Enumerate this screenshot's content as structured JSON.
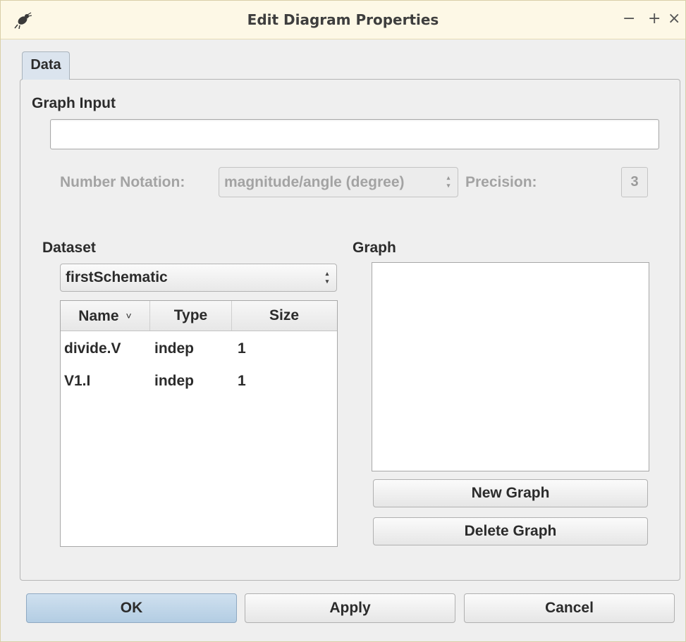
{
  "window": {
    "title": "Edit Diagram Properties",
    "controls": {
      "minimize": "−",
      "maximize": "+",
      "close": "×"
    }
  },
  "tabs": [
    {
      "label": "Data",
      "selected": true
    }
  ],
  "graph_input": {
    "label": "Graph Input",
    "value": ""
  },
  "number_notation": {
    "label": "Number Notation:",
    "selected": "magnitude/angle (degree)",
    "enabled": false
  },
  "precision": {
    "label": "Precision:",
    "value": "3",
    "enabled": false
  },
  "dataset": {
    "label": "Dataset",
    "selected": "firstSchematic",
    "columns": [
      "Name",
      "Type",
      "Size"
    ],
    "sort_column": "Name",
    "rows": [
      {
        "name": "divide.V",
        "type": "indep",
        "size": "1"
      },
      {
        "name": "V1.I",
        "type": "indep",
        "size": "1"
      }
    ]
  },
  "graph": {
    "label": "Graph",
    "items": [],
    "new_button": "New Graph",
    "delete_button": "Delete Graph"
  },
  "footer": {
    "ok": "OK",
    "apply": "Apply",
    "cancel": "Cancel"
  },
  "colors": {
    "accent_button": "#b3cde3",
    "title_bar": "#fdf8e6",
    "tab_selected": "#dbe4ee"
  },
  "icons": {
    "app": "bug-app-icon",
    "sort": "chevron-down-icon",
    "spin": "up-down-arrows-icon"
  }
}
